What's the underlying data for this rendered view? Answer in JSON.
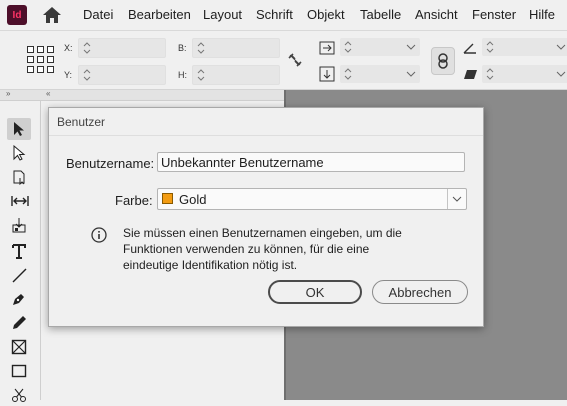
{
  "app": {
    "logo_text": "Id",
    "brand_color": "#4d0f2a",
    "logo_text_color": "#ff3366"
  },
  "menubar": {
    "home_icon": "home-icon",
    "items": [
      "Datei",
      "Bearbeiten",
      "Layout",
      "Schrift",
      "Objekt",
      "Tabelle",
      "Ansicht",
      "Fenster",
      "Hilfe"
    ]
  },
  "control_panel": {
    "x_label": "X:",
    "y_label": "Y:",
    "b_label": "B:",
    "h_label": "H:",
    "x_value": "",
    "y_value": "",
    "b_value": "",
    "h_value": ""
  },
  "dialog": {
    "title": "Benutzer",
    "username_label": "Benutzername:",
    "username_value": "Unbekannter Benutzername",
    "color_label": "Farbe:",
    "color_value": "Gold",
    "color_swatch": "#f39c12",
    "message": "Sie müssen einen Benutzernamen eingeben, um die Funktionen verwenden zu können, für die eine eindeutige Identifikation nötig ist.",
    "ok_label": "OK",
    "cancel_label": "Abbrechen"
  },
  "colors": {
    "pasteboard": "#8a8a8a",
    "chrome": "#f0f0f0"
  }
}
